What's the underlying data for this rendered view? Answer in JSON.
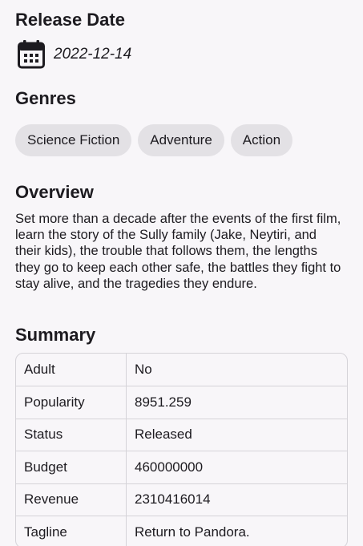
{
  "release": {
    "title": "Release Date",
    "icon": "calendar-icon",
    "date": "2022-12-14"
  },
  "genres": {
    "title": "Genres",
    "items": [
      {
        "label": "Science Fiction"
      },
      {
        "label": "Adventure"
      },
      {
        "label": "Action"
      }
    ]
  },
  "overview": {
    "title": "Overview",
    "text": "Set more than a decade after the events of the first film, learn the story of the Sully family (Jake, Neytiri, and their kids), the trouble that follows them, the lengths they go to keep each other safe, the battles they fight to stay alive, and the tragedies they endure."
  },
  "summary": {
    "title": "Summary",
    "rows": [
      {
        "key": "Adult",
        "value": "No"
      },
      {
        "key": "Popularity",
        "value": "8951.259"
      },
      {
        "key": "Status",
        "value": "Released"
      },
      {
        "key": "Budget",
        "value": "460000000"
      },
      {
        "key": "Revenue",
        "value": "2310416014"
      },
      {
        "key": "Tagline",
        "value": "Return to Pandora."
      }
    ]
  },
  "colors": {
    "background": "#f8f6f9",
    "chip": "#e3e1e5",
    "text": "#1d1b20",
    "border": "#d5d3d8"
  }
}
